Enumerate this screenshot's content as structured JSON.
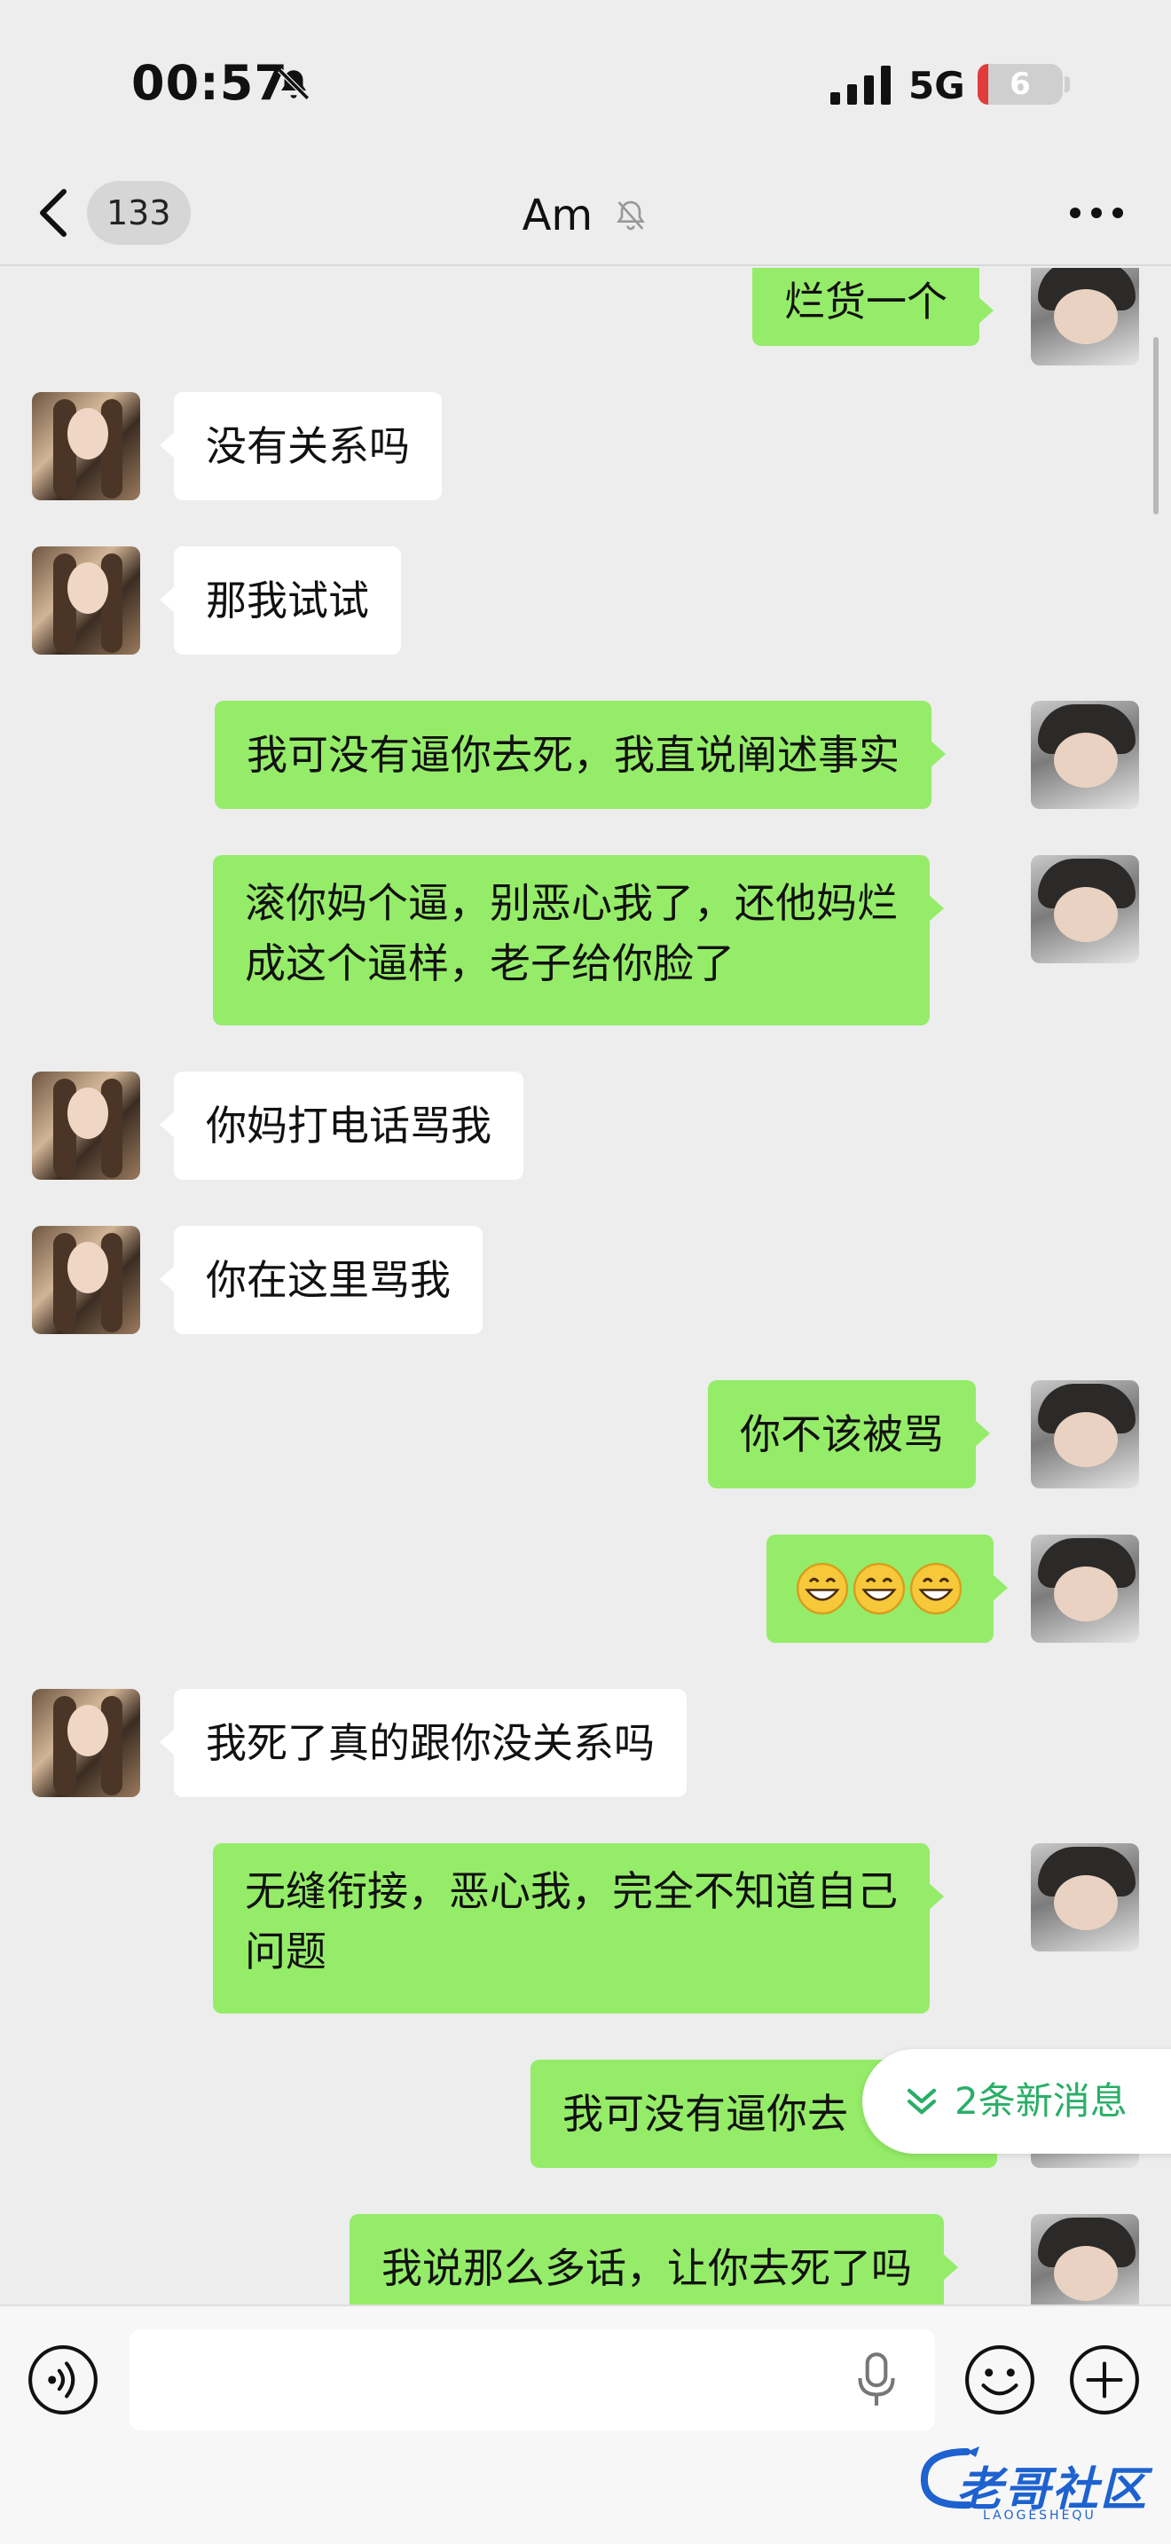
{
  "status_bar": {
    "time": "00:57",
    "network": "5G",
    "battery": "6",
    "icons": [
      "bell-slash-icon",
      "signal-icon",
      "battery-icon"
    ]
  },
  "nav": {
    "unread_count": "133",
    "title": "Am",
    "title_icon": "bell-slash-icon",
    "more_icon": "more-dots-icon"
  },
  "messages": [
    {
      "side": "right",
      "text": "烂货一个"
    },
    {
      "side": "left",
      "text": "没有关系吗"
    },
    {
      "side": "left",
      "text": "那我试试"
    },
    {
      "side": "right",
      "text": "我可没有逼你去死，我直说阐述事实"
    },
    {
      "side": "right",
      "text_lines": [
        "滚你妈个逼，别恶心我了，还他妈烂",
        "成这个逼样，老子给你脸了"
      ]
    },
    {
      "side": "left",
      "text": "你妈打电话骂我"
    },
    {
      "side": "left",
      "text": "你在这里骂我"
    },
    {
      "side": "right",
      "text": "你不该被骂"
    },
    {
      "side": "right",
      "emoji": [
        "grinning-face-emoji",
        "grinning-face-emoji",
        "grinning-face-emoji"
      ]
    },
    {
      "side": "left",
      "text": "我死了真的跟你没关系吗"
    },
    {
      "side": "right",
      "text_lines": [
        "无缝衔接，恶心我，完全不知道自己",
        "问题"
      ]
    },
    {
      "side": "right",
      "text": "我可没有逼你去"
    },
    {
      "side": "right",
      "text": "我说那么多话，让你去死了吗"
    }
  ],
  "new_messages_pill": {
    "label": "2条新消息",
    "icon": "double-chevron-down-icon"
  },
  "input_bar": {
    "voice_icon": "voice-icon",
    "mic_icon": "microphone-icon",
    "emoji_icon": "smiley-icon",
    "plus_icon": "plus-circle-icon",
    "value": ""
  },
  "watermark": {
    "text": "老哥社区",
    "sub": "LAOGESHEQU"
  },
  "colors": {
    "background": "#ededed",
    "bubble_right": "#95ec69",
    "bubble_left": "#ffffff",
    "accent_green": "#2aae67"
  }
}
